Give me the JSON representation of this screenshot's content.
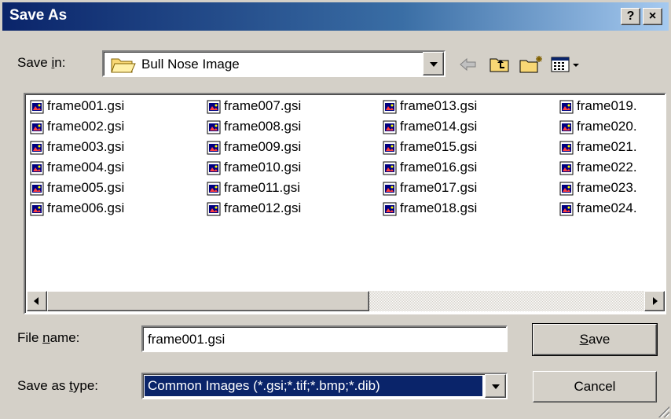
{
  "window": {
    "title": "Save As",
    "help_label": "?",
    "close_label": "×"
  },
  "save_in": {
    "label_prefix": "Save ",
    "label_mnemonic": "i",
    "label_suffix": "n:",
    "folder": "Bull Nose Image"
  },
  "toolbar": {
    "icons": [
      "back-arrow-icon",
      "up-one-level-icon",
      "create-new-folder-icon",
      "view-menu-icon"
    ]
  },
  "files": {
    "columns": [
      [
        "frame001.gsi",
        "frame002.gsi",
        "frame003.gsi",
        "frame004.gsi",
        "frame005.gsi",
        "frame006.gsi"
      ],
      [
        "frame007.gsi",
        "frame008.gsi",
        "frame009.gsi",
        "frame010.gsi",
        "frame011.gsi",
        "frame012.gsi"
      ],
      [
        "frame013.gsi",
        "frame014.gsi",
        "frame015.gsi",
        "frame016.gsi",
        "frame017.gsi",
        "frame018.gsi"
      ],
      [
        "frame019.",
        "frame020.",
        "frame021.",
        "frame022.",
        "frame023.",
        "frame024."
      ]
    ]
  },
  "file_name": {
    "label_prefix": "File ",
    "label_mnemonic": "n",
    "label_suffix": "ame:",
    "value": "frame001.gsi"
  },
  "save_as_type": {
    "label_prefix": "Save as ",
    "label_mnemonic": "t",
    "label_suffix": "ype:",
    "value": "Common Images (*.gsi;*.tif;*.bmp;*.dib)"
  },
  "buttons": {
    "save_mnemonic": "S",
    "save_suffix": "ave",
    "cancel": "Cancel"
  },
  "colors": {
    "title_start": "#0a246a",
    "title_end": "#a6caf0",
    "selection": "#0a246a",
    "face": "#d4d0c8"
  }
}
